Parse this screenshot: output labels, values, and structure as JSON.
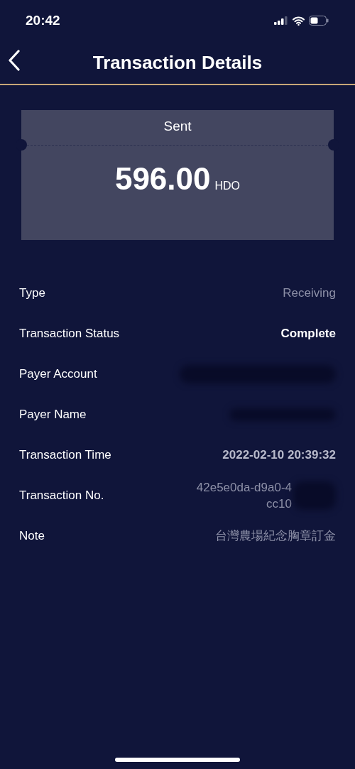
{
  "status_bar": {
    "time": "20:42"
  },
  "header": {
    "title": "Transaction Details"
  },
  "ticket": {
    "label": "Sent",
    "amount": "596.00",
    "currency": "HDO"
  },
  "details": [
    {
      "label": "Type",
      "kind": "muted",
      "value": [
        "Receiving"
      ]
    },
    {
      "label": "Transaction Status",
      "kind": "strong",
      "value": [
        "Complete"
      ]
    },
    {
      "label": "Payer Account",
      "kind": "redacted"
    },
    {
      "label": "Payer Name",
      "kind": "redacted"
    },
    {
      "label": "Transaction Time",
      "kind": "plain",
      "value": [
        "2022-02-10 20:39:32"
      ]
    },
    {
      "label": "Transaction No.",
      "kind": "partly-redacted",
      "value": [
        "42e5e0da-d9a0-4",
        "cc10"
      ]
    },
    {
      "label": "Note",
      "kind": "muted",
      "value": [
        "台灣農場紀念胸章訂金"
      ]
    }
  ]
}
